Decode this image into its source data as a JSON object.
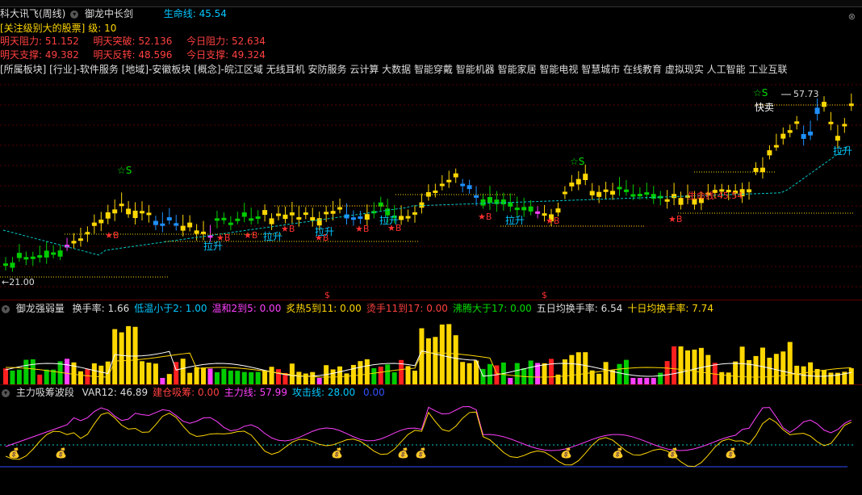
{
  "window": {
    "title_left": "科大讯飞(周线)",
    "indicator_name": "御龙中长剑",
    "life_line_label": "生命线:",
    "life_line_value": "45.54"
  },
  "info": {
    "focus_label": "[关注级别大的股票]",
    "focus_level_label": "级:",
    "focus_level_value": "10",
    "row1": [
      {
        "label": "明天阻力:",
        "value": "51.152"
      },
      {
        "label": "明天突破:",
        "value": "52.136"
      },
      {
        "label": "今日阻力:",
        "value": "52.634"
      }
    ],
    "row2": [
      {
        "label": "明天支撑:",
        "value": "49.382"
      },
      {
        "label": "明天反转:",
        "value": "48.596"
      },
      {
        "label": "今日支撑:",
        "value": "49.324"
      }
    ],
    "tags": "[所属板块]  [行业]-软件服务   [地域]-安徽板块   [概念]-皖江区域 无线耳机 安防服务 云计算 大数据 智能穿戴 智能机器 智能家居 智能电视 智慧城市 在线教育 虚拟现实 人工智能 工业互联"
  },
  "main_chart": {
    "high_label": "57.73",
    "low_label": "21.00",
    "star_s": "☆S",
    "star_b": "★B",
    "pull_up": "拉升",
    "fast_sell": "快卖",
    "life_line_tag": "生命线:45.54",
    "dollar": "$",
    "colors": {
      "up": "#ffd700",
      "down_blue": "#1e90ff",
      "green": "#00cc00",
      "magenta": "#ff40ff",
      "cyan": "#00c8c8"
    }
  },
  "panel2": {
    "name": "御龙强弱量",
    "items": [
      {
        "label": "换手率:",
        "value": "1.66",
        "color": "#dddddd"
      },
      {
        "label": "低温小于2:",
        "value": "1.00",
        "color": "#00c8ff"
      },
      {
        "label": "温和2到5:",
        "value": "0.00",
        "color": "#ff40ff"
      },
      {
        "label": "炙热5到11:",
        "value": "0.00",
        "color": "#ffd700"
      },
      {
        "label": "烫手11到17:",
        "value": "0.00",
        "color": "#ff4040"
      },
      {
        "label": "沸腾大于17:",
        "value": "0.00",
        "color": "#00dd00"
      },
      {
        "label": "五日均换手率:",
        "value": "6.54",
        "color": "#dddddd"
      },
      {
        "label": "十日均换手率:",
        "value": "7.74",
        "color": "#ffd700"
      }
    ]
  },
  "panel3": {
    "name": "主力吸筹波段",
    "items": [
      {
        "label": "VAR12:",
        "value": "46.89",
        "color": "#dddddd"
      },
      {
        "label": "建仓吸筹:",
        "value": "0.00",
        "color": "#ff4040"
      },
      {
        "label": "主力线:",
        "value": "57.99",
        "color": "#ff40ff"
      },
      {
        "label": "攻击线:",
        "value": "28.00",
        "color": "#00c8ff"
      },
      {
        "label": "",
        "value": "0.00",
        "color": "#3050ff"
      }
    ],
    "bag_icon": "💰"
  }
}
